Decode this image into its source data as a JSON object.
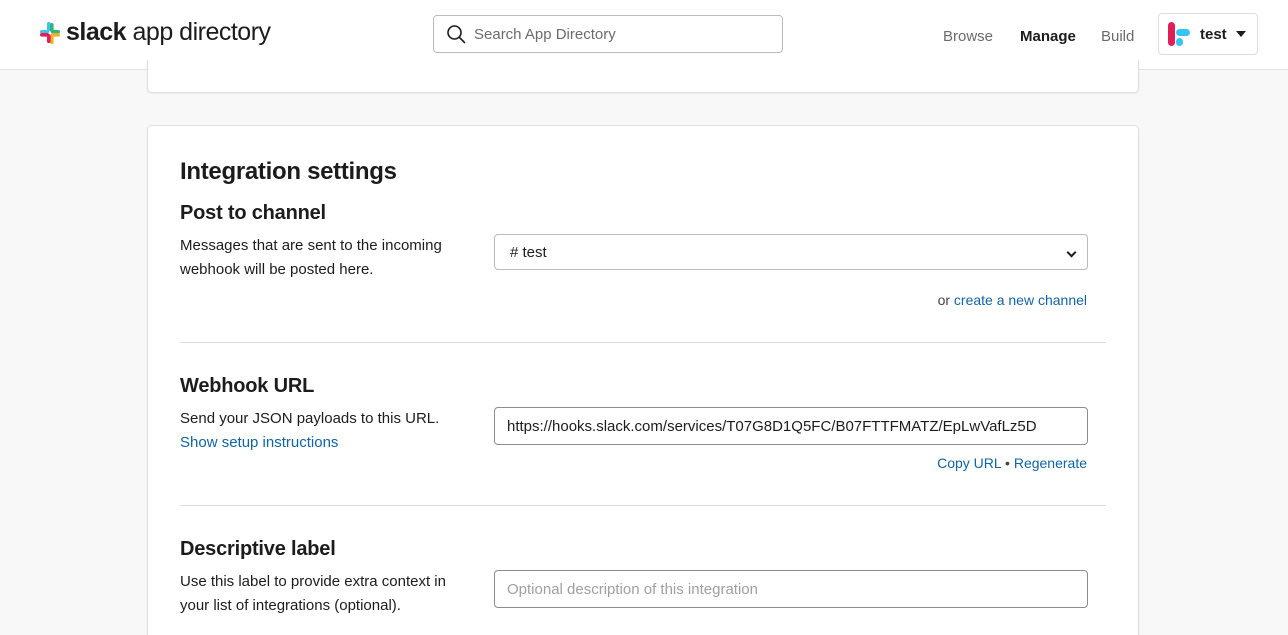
{
  "header": {
    "logo_bold": "slack",
    "logo_rest": " app directory",
    "search_placeholder": "Search App Directory",
    "nav": [
      "Browse",
      "Manage",
      "Build"
    ],
    "workspace_name": "test"
  },
  "integration": {
    "title": "Integration settings",
    "post_to_channel": {
      "heading": "Post to channel",
      "description": "Messages that are sent to the incoming webhook will be posted here.",
      "selected_channel": "# test",
      "or_text": "or ",
      "create_link": "create a new channel"
    },
    "webhook": {
      "heading": "Webhook URL",
      "description": "Send your JSON payloads to this URL.",
      "setup_link": "Show setup instructions",
      "url": "https://hooks.slack.com/services/T07G8D1Q5FC/B07FTTFMATZ/EpLwVafLz5D",
      "copy_link": "Copy URL",
      "separator": " • ",
      "regenerate_link": "Regenerate"
    },
    "label": {
      "heading": "Descriptive label",
      "description": "Use this label to provide extra context in your list of integrations (optional).",
      "placeholder": "Optional description of this integration"
    }
  },
  "colors": {
    "link": "#1264a3",
    "slack_pink": "#e01e5a",
    "slack_blue": "#36c5f0",
    "slack_green": "#2eb67d",
    "slack_yellow": "#ecb22e"
  }
}
